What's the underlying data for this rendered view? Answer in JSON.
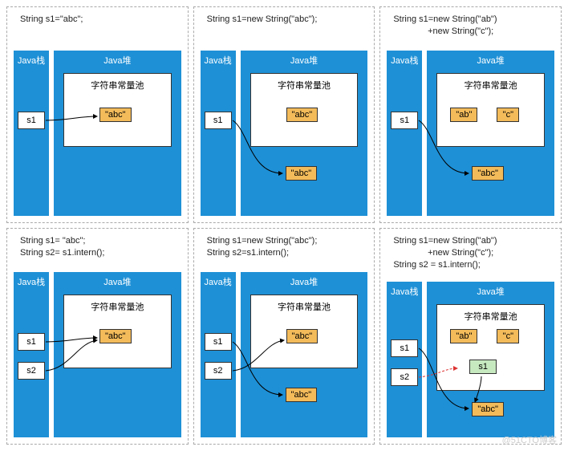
{
  "labels": {
    "stack": "Java栈",
    "heap": "Java堆",
    "pool": "字符串常量池"
  },
  "values": {
    "abc": "\"abc\"",
    "ab": "\"ab\"",
    "c": "\"c\"",
    "s1": "s1",
    "s2": "s2"
  },
  "panels": [
    {
      "code": "String s1=\"abc\";"
    },
    {
      "code": "String s1=new String(\"abc\");"
    },
    {
      "code": "String s1=new String(\"ab\")\n              +new String(\"c\");"
    },
    {
      "code": "String s1= \"abc\";\nString s2= s1.intern();"
    },
    {
      "code": "String s1=new String(\"abc\");\nString s2=s1.intern();"
    },
    {
      "code": "String s1=new String(\"ab\")\n              +new String(\"c\");\nString s2 = s1.intern();"
    }
  ],
  "watermark": "@51CTO博客"
}
